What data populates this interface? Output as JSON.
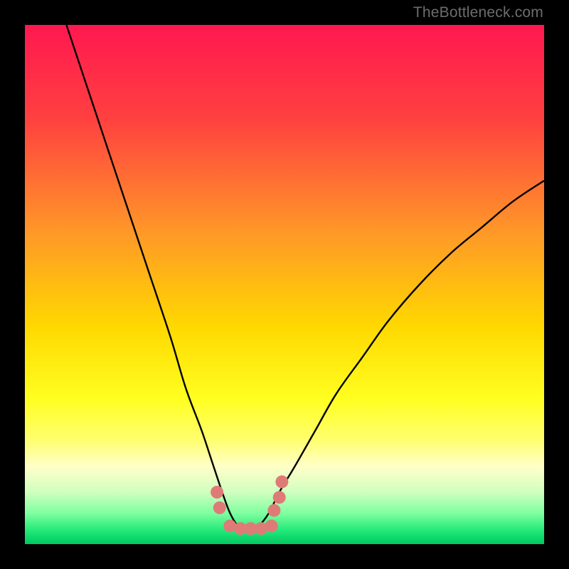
{
  "watermark": "TheBottleneck.com",
  "chart_data": {
    "type": "line",
    "title": "",
    "xlabel": "",
    "ylabel": "",
    "xlim": [
      0,
      100
    ],
    "ylim": [
      0,
      100
    ],
    "grid": false,
    "legend": false,
    "series": [
      {
        "name": "bottleneck-curve",
        "x": [
          8,
          12,
          16,
          20,
          24,
          28,
          31,
          34,
          36,
          38,
          39.5,
          41,
          42,
          43.5,
          45,
          47,
          49,
          52,
          56,
          60,
          65,
          70,
          76,
          82,
          88,
          94,
          100
        ],
        "y": [
          100,
          88,
          76,
          64,
          52,
          40,
          30,
          22,
          16,
          10,
          6,
          3.5,
          3,
          3,
          3.5,
          6,
          10,
          15,
          22,
          29,
          36,
          43,
          50,
          56,
          61,
          66,
          70
        ]
      }
    ],
    "scatter_points": {
      "name": "salmon-markers",
      "color": "#df7b76",
      "x": [
        37,
        37.5,
        39.5,
        41.5,
        43.5,
        45.5,
        47.5,
        48,
        49,
        49.5
      ],
      "y": [
        10,
        7,
        3.5,
        3,
        3,
        3,
        3.5,
        6.5,
        9,
        12
      ]
    },
    "gradient_stops": [
      {
        "offset": 0.0,
        "color": "#ff1850"
      },
      {
        "offset": 0.18,
        "color": "#ff4040"
      },
      {
        "offset": 0.4,
        "color": "#ff9828"
      },
      {
        "offset": 0.58,
        "color": "#ffd800"
      },
      {
        "offset": 0.72,
        "color": "#ffff20"
      },
      {
        "offset": 0.8,
        "color": "#ffff70"
      },
      {
        "offset": 0.85,
        "color": "#ffffc8"
      },
      {
        "offset": 0.9,
        "color": "#d0ffc0"
      },
      {
        "offset": 0.94,
        "color": "#80ffa0"
      },
      {
        "offset": 0.975,
        "color": "#20e878"
      },
      {
        "offset": 1.0,
        "color": "#00c860"
      }
    ]
  }
}
